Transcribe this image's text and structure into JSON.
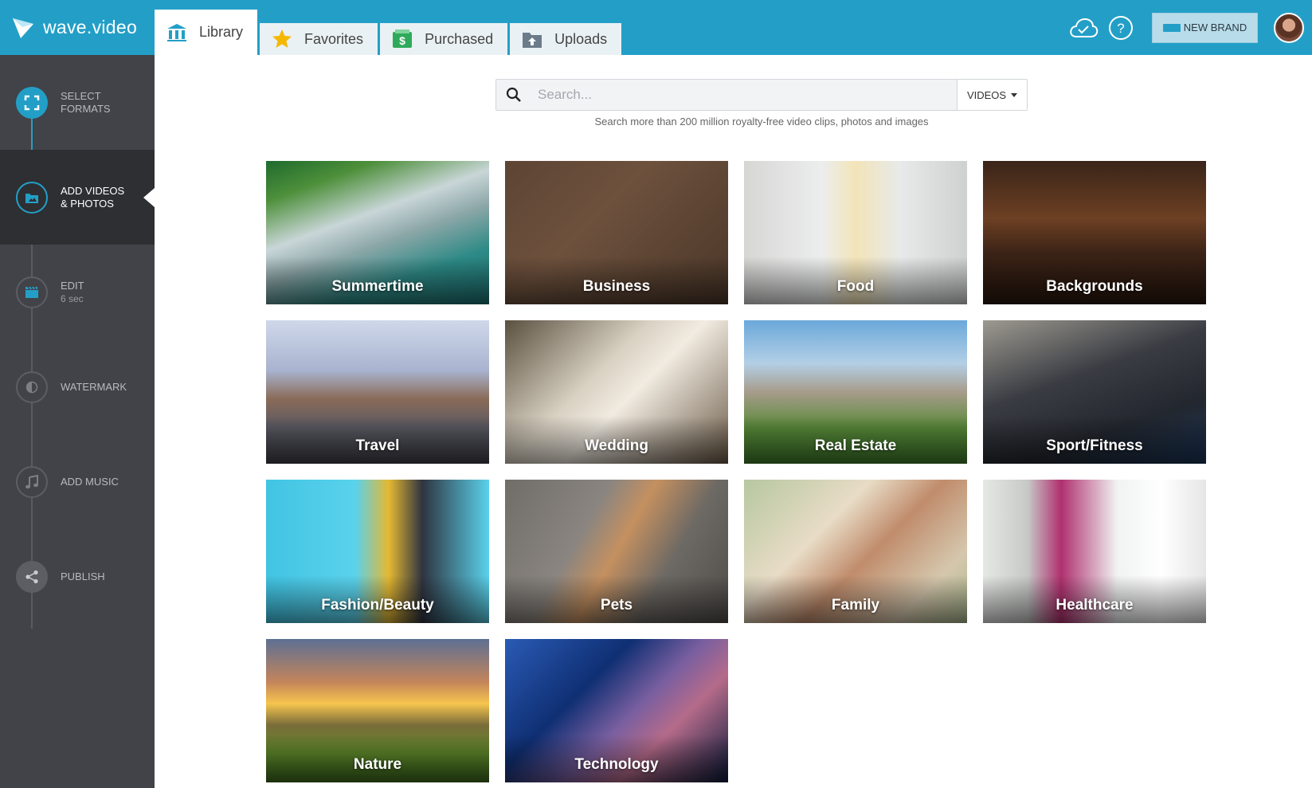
{
  "app": {
    "brand_name": "wave.video"
  },
  "tabs": [
    {
      "label": "Library",
      "icon": "library-icon",
      "active": true
    },
    {
      "label": "Favorites",
      "icon": "star-icon",
      "active": false
    },
    {
      "label": "Purchased",
      "icon": "dollar-icon",
      "active": false
    },
    {
      "label": "Uploads",
      "icon": "upload-folder-icon",
      "active": false
    }
  ],
  "header_right": {
    "cloud_icon": "cloud-check-icon",
    "help_icon": "help-icon",
    "new_brand_label": "NEW BRAND"
  },
  "steps": [
    {
      "label": "SELECT FORMATS",
      "line1": "SELECT",
      "line2": "FORMATS",
      "sub": "",
      "icon": "formats-icon",
      "state": "done"
    },
    {
      "label": "ADD VIDEOS & PHOTOS",
      "line1": "ADD VIDEOS",
      "line2": "& PHOTOS",
      "sub": "",
      "icon": "media-icon",
      "state": "active"
    },
    {
      "label": "EDIT",
      "line1": "EDIT",
      "line2": "",
      "sub": "6 sec",
      "icon": "clapperboard-icon",
      "state": "pending"
    },
    {
      "label": "WATERMARK",
      "line1": "WATERMARK",
      "line2": "",
      "sub": "",
      "icon": "watermark-icon",
      "state": "pending"
    },
    {
      "label": "ADD MUSIC",
      "line1": "ADD MUSIC",
      "line2": "",
      "sub": "",
      "icon": "music-icon",
      "state": "pending"
    },
    {
      "label": "PUBLISH",
      "line1": "PUBLISH",
      "line2": "",
      "sub": "",
      "icon": "share-icon",
      "state": "pending"
    }
  ],
  "search": {
    "placeholder": "Search...",
    "value": "",
    "type_selected": "VIDEOS",
    "hint": "Search more than 200 million royalty-free video clips, photos and images"
  },
  "categories": [
    {
      "name": "Summertime"
    },
    {
      "name": "Business"
    },
    {
      "name": "Food"
    },
    {
      "name": "Backgrounds"
    },
    {
      "name": "Travel"
    },
    {
      "name": "Wedding"
    },
    {
      "name": "Real Estate"
    },
    {
      "name": "Sport/Fitness"
    },
    {
      "name": "Fashion/Beauty"
    },
    {
      "name": "Pets"
    },
    {
      "name": "Family"
    },
    {
      "name": "Healthcare"
    },
    {
      "name": "Nature"
    },
    {
      "name": "Technology"
    }
  ],
  "colors": {
    "accent": "#239fc7",
    "sidebar": "#414349",
    "sidebar_active": "#2d2f33"
  }
}
